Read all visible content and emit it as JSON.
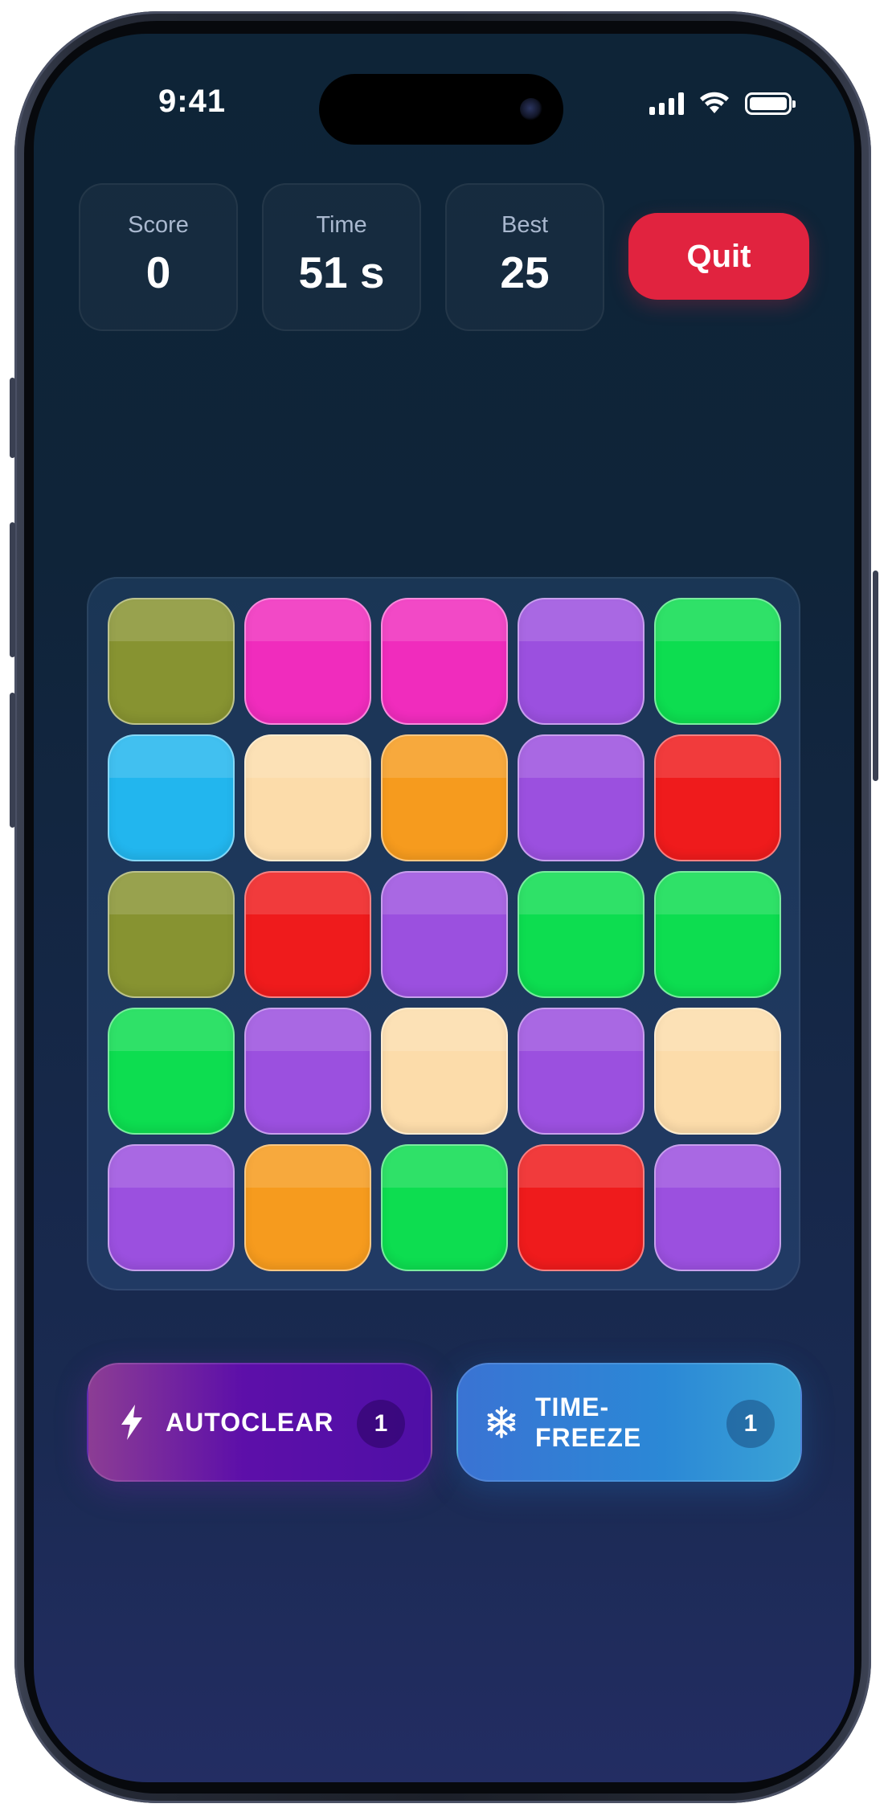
{
  "status_bar": {
    "time": "9:41"
  },
  "stats": [
    {
      "label": "Score",
      "value": "0"
    },
    {
      "label": "Time",
      "value": "51 s"
    },
    {
      "label": "Best",
      "value": "25"
    }
  ],
  "quit_label": "Quit",
  "board": {
    "rows": 5,
    "cols": 5,
    "tiles": [
      [
        "olive",
        "magenta",
        "magenta",
        "purple",
        "green"
      ],
      [
        "sky",
        "cream",
        "orange",
        "purple",
        "red"
      ],
      [
        "olive",
        "red",
        "purple",
        "green",
        "green"
      ],
      [
        "green",
        "purple",
        "cream",
        "purple",
        "cream"
      ],
      [
        "purple",
        "orange",
        "green",
        "red",
        "purple"
      ]
    ],
    "colors": {
      "olive": "#879331",
      "magenta": "#f02cbd",
      "purple": "#9b50df",
      "green": "#0ddd50",
      "sky": "#22b6ee",
      "cream": "#fcdcaa",
      "orange": "#f69b1e",
      "red": "#ef1b1c"
    }
  },
  "powerups": {
    "autoclear": {
      "label": "AUTOCLEAR",
      "count": "1",
      "icon": "lightning-bolt-icon"
    },
    "timefreeze": {
      "label_line1": "TIME-",
      "label_line2": "FREEZE",
      "count": "1",
      "icon": "snowflake-icon"
    }
  }
}
